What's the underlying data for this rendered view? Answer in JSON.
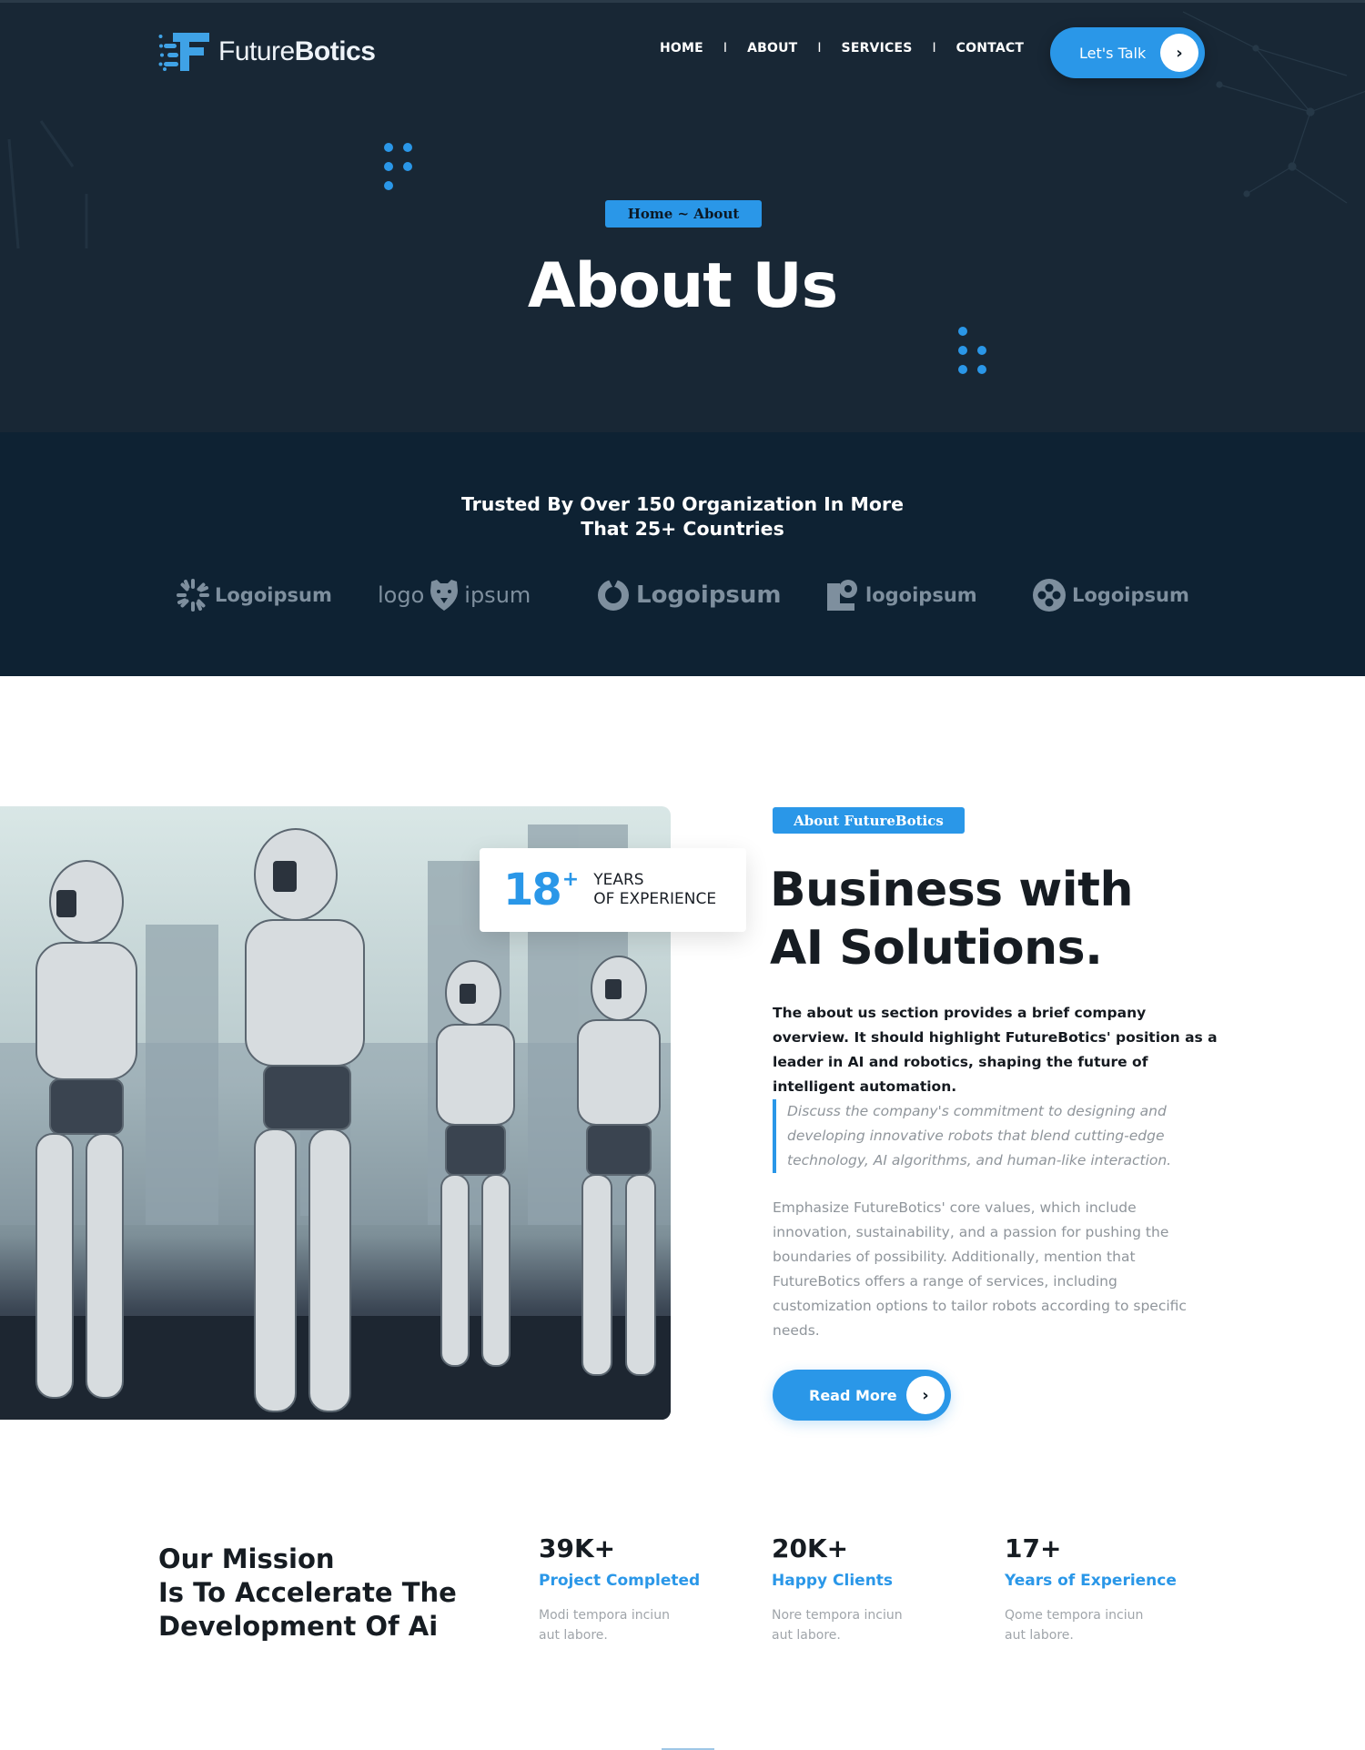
{
  "brand": {
    "name_light": "Future",
    "name_bold": "Botics",
    "accent_color": "#2a97e8",
    "dark_bg": "#182735",
    "trusted_bg": "#0e2233"
  },
  "nav": {
    "items": [
      {
        "label": "HOME"
      },
      {
        "label": "ABOUT"
      },
      {
        "label": "SERVICES"
      },
      {
        "label": "CONTACT"
      }
    ],
    "separator": "I",
    "cta_label": "Let's Talk",
    "cta_icon": "chevron-right-icon"
  },
  "hero": {
    "breadcrumb": "Home ~ About",
    "title": "About Us"
  },
  "trusted": {
    "title_line1": "Trusted By Over 150 Organization In More",
    "title_line2": "That 25+ Countries",
    "logos": [
      {
        "label": "Logoipsum",
        "icon": "sunburst-logo-icon"
      },
      {
        "label_left": "logo",
        "label_right": "ipsum",
        "icon": "bear-logo-icon"
      },
      {
        "label": "Logoipsum",
        "icon": "ring-logo-icon"
      },
      {
        "label": "logoipsum",
        "icon": "square-pin-logo-icon"
      },
      {
        "label": "Logoipsum",
        "icon": "clover-logo-icon"
      }
    ]
  },
  "about": {
    "image_alt": "Humanoid robots standing in front of a city skyline",
    "experience": {
      "number": "18",
      "suffix": "+",
      "line1": "YEARS",
      "line2": "OF EXPERIENCE"
    },
    "tag": "About FutureBotics",
    "title_line1": "Business with",
    "title_line2": "AI Solutions.",
    "lead": "The about us section provides a brief company overview. It should highlight FutureBotics' position as a leader in AI and robotics, shaping the future of intelligent automation.",
    "quote": "Discuss the company's commitment to designing and developing innovative robots that blend cutting-edge technology, AI algorithms, and human-like interaction.",
    "body": "Emphasize FutureBotics' core values, which include innovation, sustainability, and a passion for pushing the boundaries of possibility. Additionally, mention that FutureBotics offers a range of services, including customization options to tailor robots according to specific needs.",
    "read_more_label": "Read More"
  },
  "mission": {
    "line1": "Our Mission",
    "line2": "Is To Accelerate The",
    "line3": "Development Of Ai"
  },
  "stats": [
    {
      "value": "39K+",
      "label": "Project Completed",
      "desc": "Modi tempora inciun aut labore."
    },
    {
      "value": "20K+",
      "label": "Happy Clients",
      "desc": "Nore tempora inciun aut labore."
    },
    {
      "value": "17+",
      "label": "Years of Experience",
      "desc": "Qome tempora inciun aut labore."
    }
  ]
}
